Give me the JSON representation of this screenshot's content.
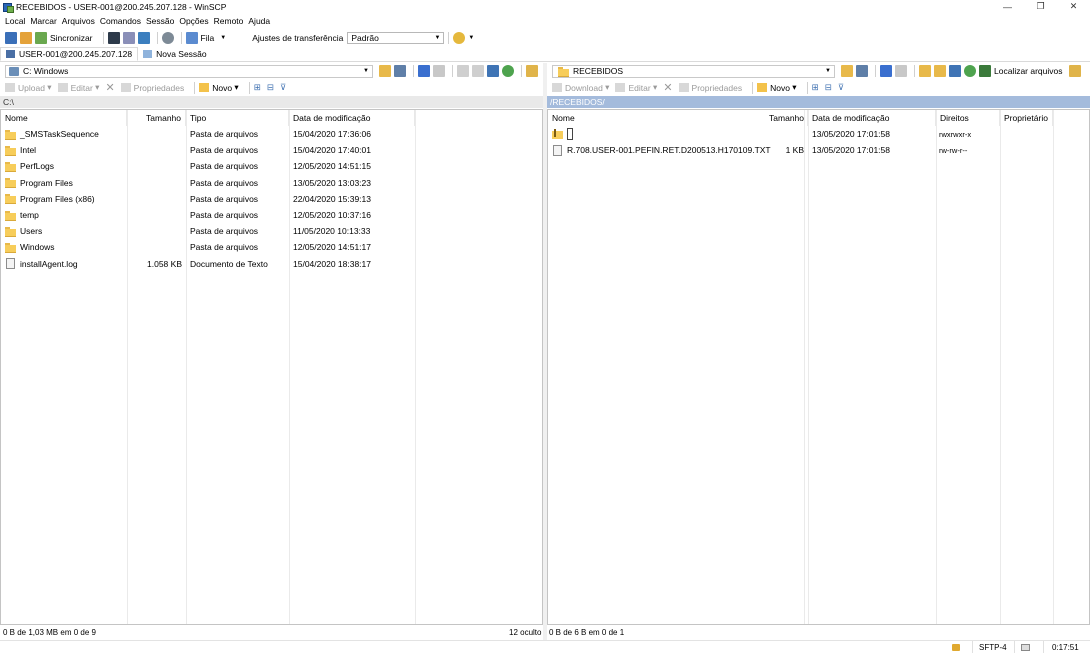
{
  "window": {
    "title": "RECEBIDOS - USER-001@200.245.207.128 - WinSCP",
    "minimize": "—",
    "maximize": "❐",
    "close": "✕"
  },
  "menu": [
    "Local",
    "Marcar",
    "Arquivos",
    "Comandos",
    "Sessão",
    "Opções",
    "Remoto",
    "Ajuda"
  ],
  "toolbar": {
    "sync_label": "Sincronizar",
    "queue_label": "Fila",
    "transfer_settings_label": "Ajustes de transferência",
    "transfer_preset": "Padrão"
  },
  "tabs": {
    "session": "USER-001@200.245.207.128",
    "new_session": "Nova Sessão"
  },
  "left_panel": {
    "drive": "C: Windows",
    "path": "C:\\",
    "actions": {
      "upload": "Upload",
      "edit": "Editar",
      "properties": "Propriedades",
      "new": "Novo"
    },
    "columns": [
      "Nome",
      "Tamanho",
      "Tipo",
      "Data de modificação"
    ],
    "rows": [
      {
        "name": "_SMSTaskSequence",
        "size": "",
        "type": "Pasta de arquivos",
        "date": "15/04/2020  17:36:06",
        "kind": "folder"
      },
      {
        "name": "Intel",
        "size": "",
        "type": "Pasta de arquivos",
        "date": "15/04/2020  17:40:01",
        "kind": "folder"
      },
      {
        "name": "PerfLogs",
        "size": "",
        "type": "Pasta de arquivos",
        "date": "12/05/2020  14:51:15",
        "kind": "folder"
      },
      {
        "name": "Program Files",
        "size": "",
        "type": "Pasta de arquivos",
        "date": "13/05/2020  13:03:23",
        "kind": "folder"
      },
      {
        "name": "Program Files (x86)",
        "size": "",
        "type": "Pasta de arquivos",
        "date": "22/04/2020  15:39:13",
        "kind": "folder"
      },
      {
        "name": "temp",
        "size": "",
        "type": "Pasta de arquivos",
        "date": "12/05/2020  10:37:16",
        "kind": "folder"
      },
      {
        "name": "Users",
        "size": "",
        "type": "Pasta de arquivos",
        "date": "11/05/2020  10:13:33",
        "kind": "folder"
      },
      {
        "name": "Windows",
        "size": "",
        "type": "Pasta de arquivos",
        "date": "12/05/2020  14:51:17",
        "kind": "folder"
      },
      {
        "name": "installAgent.log",
        "size": "1.058 KB",
        "type": "Documento de Texto",
        "date": "15/04/2020  18:38:17",
        "kind": "file"
      }
    ],
    "status": "0 B de 1,03 MB em 0 de 9",
    "hidden": "12 oculto"
  },
  "right_panel": {
    "folder": "RECEBIDOS",
    "path": "/RECEBIDOS/",
    "find_files": "Localizar arquivos",
    "actions": {
      "download": "Download",
      "edit": "Editar",
      "properties": "Propriedades",
      "new": "Novo"
    },
    "columns": [
      "Nome",
      "Tamanho",
      "Data de modificação",
      "Direitos",
      "Proprietário"
    ],
    "rows": [
      {
        "name": "..",
        "size": "",
        "date": "13/05/2020 17:01:58",
        "rights": "rwxrwxr-x",
        "owner": "",
        "kind": "updir"
      },
      {
        "name": "R.708.USER-001.PEFIN.RET.D200513.H170109.TXT",
        "size": "1 KB",
        "date": "13/05/2020 17:01:58",
        "rights": "rw-rw-r--",
        "owner": "",
        "kind": "file"
      }
    ],
    "status": "0 B de 6 B em 0 de 1"
  },
  "statusbar": {
    "protocol": "SFTP-4",
    "elapsed": "0:17:51"
  }
}
